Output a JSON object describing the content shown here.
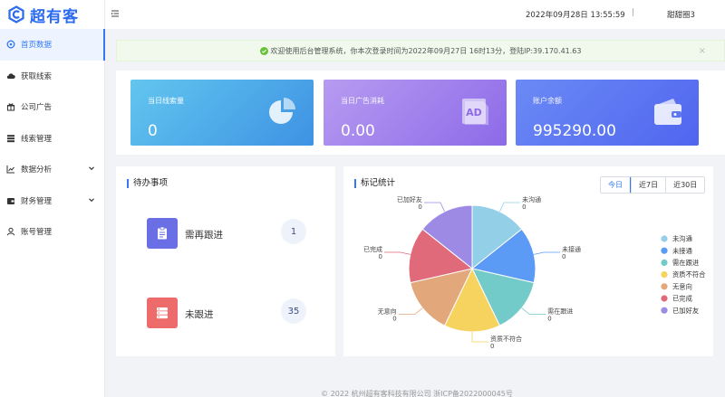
{
  "app": {
    "brand": "超有客"
  },
  "header": {
    "datetime": "2022年09月28日 13:55:59",
    "separator": "|",
    "user": "甜甜圈3"
  },
  "sidebar": {
    "items": [
      {
        "label": "首页数据",
        "icon": "home-icon",
        "active": true
      },
      {
        "label": "获取线索",
        "icon": "cloud-icon"
      },
      {
        "label": "公司广告",
        "icon": "gift-icon"
      },
      {
        "label": "线索管理",
        "icon": "list-icon"
      },
      {
        "label": "数据分析",
        "icon": "chart-icon",
        "expandable": true
      },
      {
        "label": "财务管理",
        "icon": "wallet-icon",
        "expandable": true
      },
      {
        "label": "账号管理",
        "icon": "user-icon"
      }
    ]
  },
  "notice": {
    "text": "欢迎使用后台管理系统，你本次登录时间为2022年09月27日 16时13分，登陆IP:39.170.41.63",
    "close": "×"
  },
  "stats": [
    {
      "label": "当日线索量",
      "value": "0",
      "icon": "pie-icon"
    },
    {
      "label": "当日广告消耗",
      "value": "0.00",
      "icon": "ad-icon"
    },
    {
      "label": "账户余额",
      "value": "995290.00",
      "icon": "wallet-icon"
    }
  ],
  "todo": {
    "title": "待办事项",
    "items": [
      {
        "label": "需再跟进",
        "count": "1",
        "icon": "clipboard-icon"
      },
      {
        "label": "未跟进",
        "count": "35",
        "icon": "server-icon"
      }
    ]
  },
  "chart_panel": {
    "title": "标记统计",
    "tabs": [
      {
        "label": "今日",
        "active": true
      },
      {
        "label": "近7日"
      },
      {
        "label": "近30日"
      }
    ]
  },
  "chart_data": {
    "type": "pie",
    "title": "标记统计",
    "categories": [
      "未沟通",
      "未接通",
      "需在跟进",
      "资质不符合",
      "无意向",
      "已完成",
      "已加好友"
    ],
    "values": [
      0,
      0,
      0,
      0,
      0,
      0,
      0
    ],
    "colors": [
      "#93d0e8",
      "#5b9af5",
      "#72cbc8",
      "#f6d25e",
      "#e3a77c",
      "#e06a7a",
      "#9c8ae5"
    ],
    "legend": "right"
  },
  "footer": {
    "text": "© 2022 杭州超有客科技有限公司 浙ICP备2022000045号"
  }
}
